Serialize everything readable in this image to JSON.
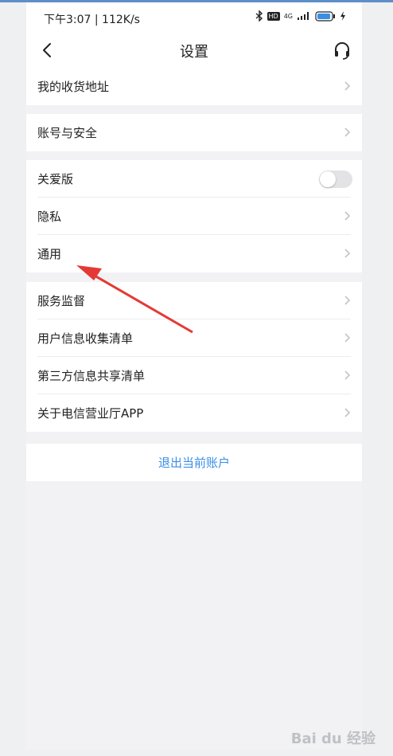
{
  "status": {
    "time_speed": "下午3:07 | 112K/s",
    "network": "4G"
  },
  "nav": {
    "title": "设置",
    "back_icon": "chevron-left-icon",
    "service_icon": "headset-icon"
  },
  "groups": [
    {
      "items": [
        {
          "label": "我的收货地址",
          "type": "link"
        }
      ]
    },
    {
      "items": [
        {
          "label": "账号与安全",
          "type": "link"
        }
      ]
    },
    {
      "items": [
        {
          "label": "关爱版",
          "type": "toggle",
          "on": false
        },
        {
          "label": "隐私",
          "type": "link"
        },
        {
          "label": "通用",
          "type": "link"
        }
      ]
    },
    {
      "items": [
        {
          "label": "服务监督",
          "type": "link"
        },
        {
          "label": "用户信息收集清单",
          "type": "link"
        },
        {
          "label": "第三方信息共享清单",
          "type": "link"
        },
        {
          "label": "关于电信营业厅APP",
          "type": "link"
        }
      ]
    }
  ],
  "logout_label": "退出当前账户",
  "colors": {
    "accent": "#3a8ee6",
    "annotation_arrow": "#e53935"
  },
  "watermark": "Bai du 经验"
}
